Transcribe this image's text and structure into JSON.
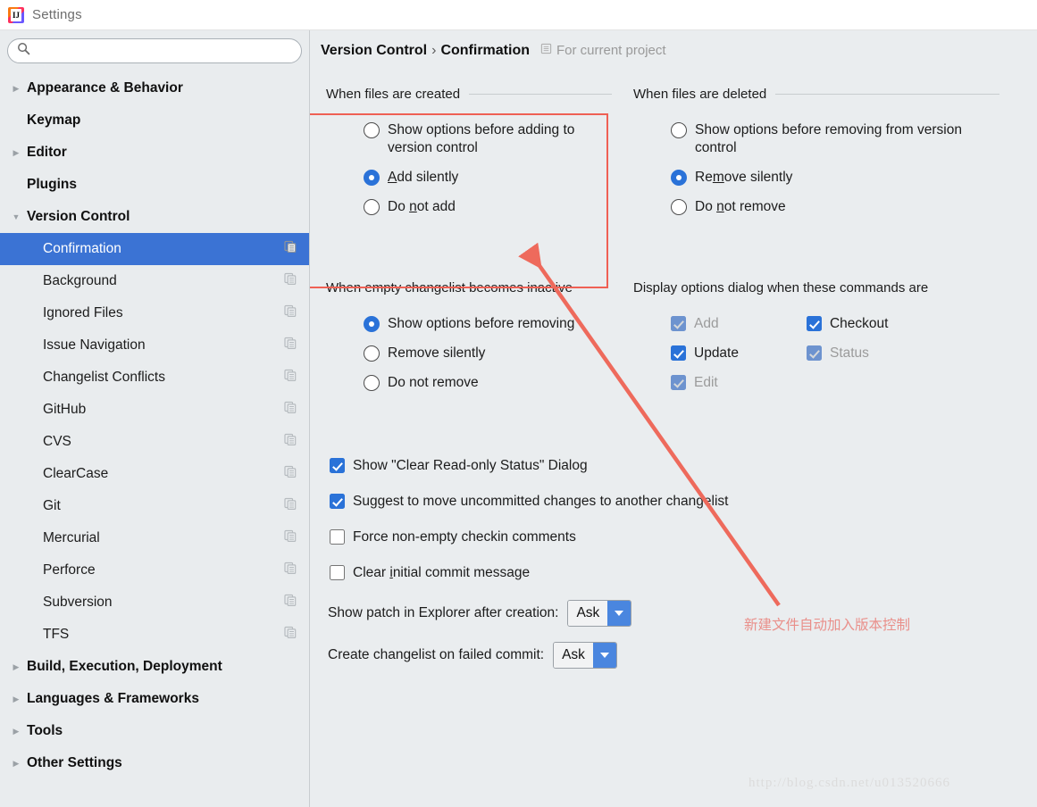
{
  "window": {
    "title": "Settings",
    "app_icon": "intellij-logo-icon"
  },
  "sidebar": {
    "search": {
      "value": "",
      "placeholder": ""
    },
    "items": [
      {
        "label": "Appearance & Behavior",
        "level": "top",
        "arrow": "collapsed",
        "copy_icon": false,
        "selected": false
      },
      {
        "label": "Keymap",
        "level": "top",
        "arrow": "none",
        "copy_icon": false,
        "selected": false
      },
      {
        "label": "Editor",
        "level": "top",
        "arrow": "collapsed",
        "copy_icon": false,
        "selected": false
      },
      {
        "label": "Plugins",
        "level": "top",
        "arrow": "none",
        "copy_icon": false,
        "selected": false
      },
      {
        "label": "Version Control",
        "level": "top",
        "arrow": "expanded",
        "copy_icon": false,
        "selected": false
      },
      {
        "label": "Confirmation",
        "level": "child",
        "arrow": "none",
        "copy_icon": true,
        "selected": true
      },
      {
        "label": "Background",
        "level": "child",
        "arrow": "none",
        "copy_icon": true,
        "selected": false
      },
      {
        "label": "Ignored Files",
        "level": "child",
        "arrow": "none",
        "copy_icon": true,
        "selected": false
      },
      {
        "label": "Issue Navigation",
        "level": "child",
        "arrow": "none",
        "copy_icon": true,
        "selected": false
      },
      {
        "label": "Changelist Conflicts",
        "level": "child",
        "arrow": "none",
        "copy_icon": true,
        "selected": false
      },
      {
        "label": "GitHub",
        "level": "child",
        "arrow": "none",
        "copy_icon": true,
        "selected": false
      },
      {
        "label": "CVS",
        "level": "child",
        "arrow": "none",
        "copy_icon": true,
        "selected": false
      },
      {
        "label": "ClearCase",
        "level": "child",
        "arrow": "none",
        "copy_icon": true,
        "selected": false
      },
      {
        "label": "Git",
        "level": "child",
        "arrow": "none",
        "copy_icon": true,
        "selected": false
      },
      {
        "label": "Mercurial",
        "level": "child",
        "arrow": "none",
        "copy_icon": true,
        "selected": false
      },
      {
        "label": "Perforce",
        "level": "child",
        "arrow": "none",
        "copy_icon": true,
        "selected": false
      },
      {
        "label": "Subversion",
        "level": "child",
        "arrow": "none",
        "copy_icon": true,
        "selected": false
      },
      {
        "label": "TFS",
        "level": "child",
        "arrow": "none",
        "copy_icon": true,
        "selected": false
      },
      {
        "label": "Build, Execution, Deployment",
        "level": "top",
        "arrow": "collapsed",
        "copy_icon": false,
        "selected": false
      },
      {
        "label": "Languages & Frameworks",
        "level": "top",
        "arrow": "collapsed",
        "copy_icon": false,
        "selected": false
      },
      {
        "label": "Tools",
        "level": "top",
        "arrow": "collapsed",
        "copy_icon": false,
        "selected": false
      },
      {
        "label": "Other Settings",
        "level": "top",
        "arrow": "collapsed",
        "copy_icon": false,
        "selected": false
      }
    ]
  },
  "header": {
    "crumb1": "Version Control",
    "separator": "›",
    "crumb2": "Confirmation",
    "scope_label": "For current project",
    "scope_icon": "project-scope-icon"
  },
  "groups": {
    "created": {
      "title": "When files are created",
      "options": [
        {
          "label": "Show options before adding to version control",
          "selected": false,
          "mnemonic": ""
        },
        {
          "label": "Add silently",
          "selected": true,
          "mnemonic": "A"
        },
        {
          "label": "Do not add",
          "selected": false,
          "mnemonic": "n"
        }
      ]
    },
    "deleted": {
      "title": "When files are deleted",
      "options": [
        {
          "label": "Show options before removing from version control",
          "selected": false,
          "mnemonic": ""
        },
        {
          "label": "Remove silently",
          "selected": true,
          "mnemonic": "m"
        },
        {
          "label": "Do not remove",
          "selected": false,
          "mnemonic": "n"
        }
      ]
    },
    "changelist": {
      "title": "When empty changelist becomes inactive",
      "options": [
        {
          "label": "Show options before removing",
          "selected": true
        },
        {
          "label": "Remove silently",
          "selected": false
        },
        {
          "label": "Do not remove",
          "selected": false
        }
      ]
    },
    "commands": {
      "title": "Display options dialog when these commands are",
      "column_left": [
        {
          "label": "Add",
          "checked": true,
          "enabled": false
        },
        {
          "label": "Update",
          "checked": true,
          "enabled": true
        },
        {
          "label": "Edit",
          "checked": true,
          "enabled": false
        }
      ],
      "column_right": [
        {
          "label": "Checkout",
          "checked": true,
          "enabled": true
        },
        {
          "label": "Status",
          "checked": true,
          "enabled": false
        }
      ]
    }
  },
  "checkboxes": [
    {
      "label": "Show \"Clear Read-only Status\" Dialog",
      "checked": true
    },
    {
      "label": "Suggest to move uncommitted changes to another changelist",
      "checked": true
    },
    {
      "label": "Force non-empty checkin comments",
      "checked": false
    },
    {
      "label": "Clear initial commit message",
      "checked": false
    }
  ],
  "combos": [
    {
      "label": "Show patch in Explorer after creation:",
      "value": "Ask"
    },
    {
      "label": "Create changelist on failed commit:",
      "value": "Ask"
    }
  ],
  "annotations": {
    "note_text": "新建文件自动加入版本控制",
    "note_color": "#e98f8a",
    "highlight_color": "#ef6054",
    "arrow_color": "#ee6a5c"
  },
  "watermark": {
    "text": "http://blog.csdn.net/u013520666"
  }
}
